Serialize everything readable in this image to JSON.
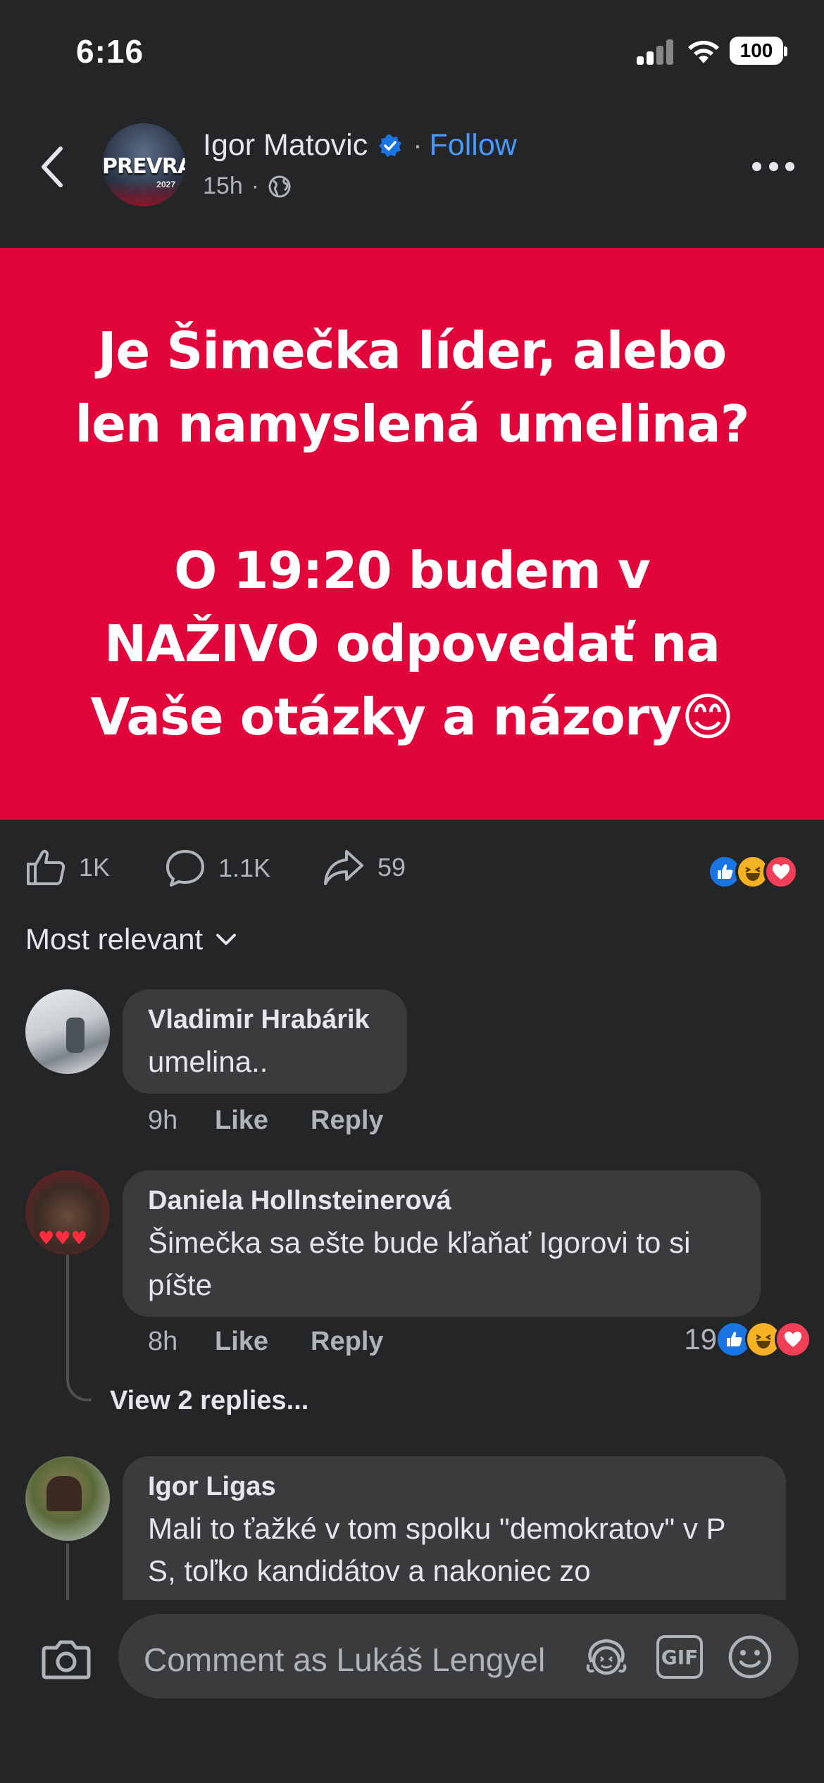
{
  "status_bar": {
    "time": "6:16",
    "battery": "100"
  },
  "header": {
    "avatar_logo": "PREVRAT",
    "avatar_year": "2027",
    "author": "Igor Matovic",
    "separator": "·",
    "follow_label": "Follow",
    "timestamp": "15h",
    "meta_separator": "·"
  },
  "post": {
    "banner_lines_1": [
      "Je Šimečka líder, alebo",
      "len namyslená umelina?"
    ],
    "banner_lines_2": [
      "O 19:20 budem v",
      "NAŽIVO odpovedať na",
      "Vaše otázky a názory😊"
    ]
  },
  "actions": {
    "likes": "1K",
    "comments": "1.1K",
    "shares": "59"
  },
  "sort": {
    "label": "Most relevant"
  },
  "comments": [
    {
      "author": "Vladimir Hrabárik",
      "text": "umelina..",
      "time": "9h",
      "like": "Like",
      "reply": "Reply"
    },
    {
      "author": "Daniela Hollnsteinerová",
      "text": "Šimečka sa ešte bude kľaňať Igorovi to si píšte",
      "time": "8h",
      "like": "Like",
      "reply": "Reply",
      "reaction_count": "19",
      "view_replies": "View 2 replies..."
    },
    {
      "author": "Igor Ligas",
      "text": "Mali to ťažké v tom spolku \"demokratov\" v P S, toľko kandidátov a nakoniec zo"
    }
  ],
  "composer": {
    "placeholder": "Comment as Lukáš Lengyel",
    "gif_label": "GIF"
  },
  "colors": {
    "background": "#242526",
    "bubble": "#3a3b3c",
    "accent": "#4599ff",
    "banner": "#e2053c"
  }
}
